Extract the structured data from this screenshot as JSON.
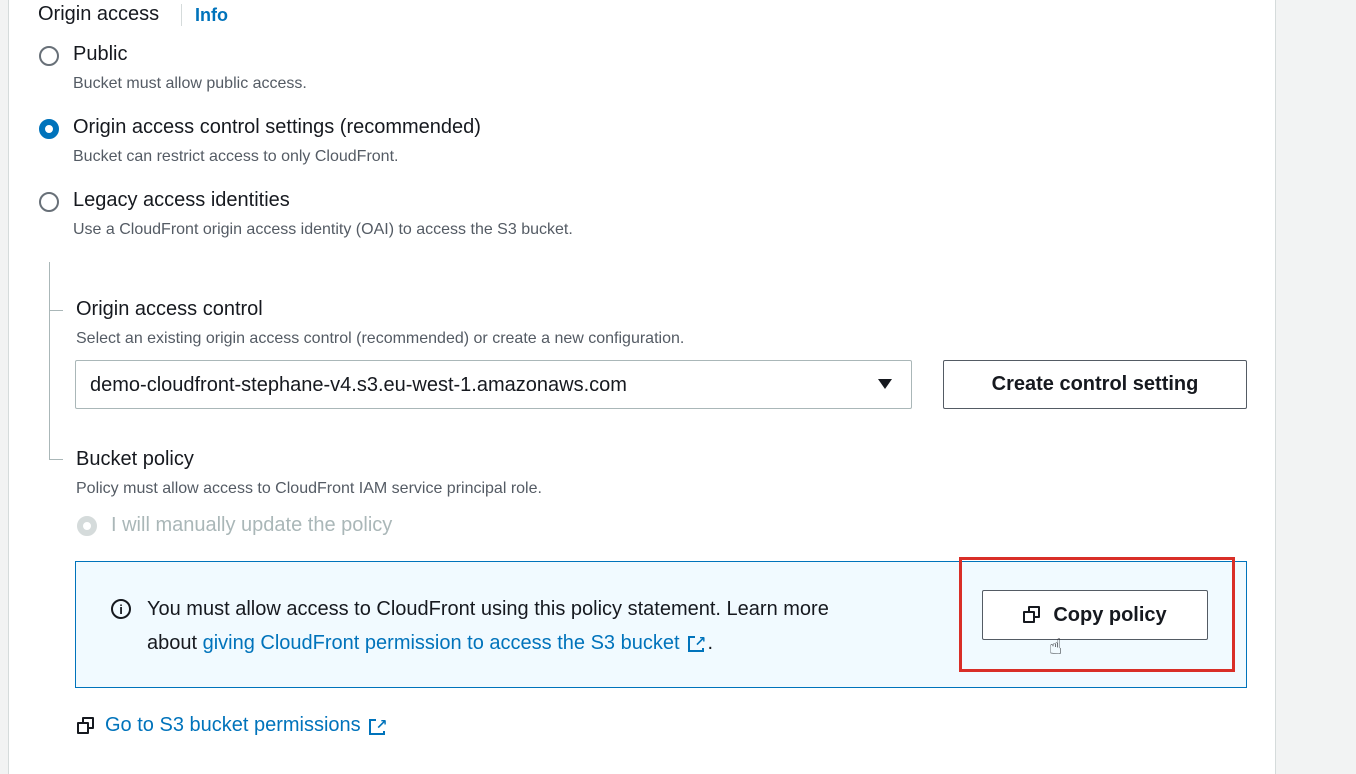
{
  "origin_access": {
    "label": "Origin access",
    "info": "Info",
    "options": [
      {
        "title": "Public",
        "desc": "Bucket must allow public access.",
        "checked": false
      },
      {
        "title": "Origin access control settings (recommended)",
        "desc": "Bucket can restrict access to only CloudFront.",
        "checked": true
      },
      {
        "title": "Legacy access identities",
        "desc": "Use a CloudFront origin access identity (OAI) to access the S3 bucket.",
        "checked": false
      }
    ]
  },
  "origin_access_control": {
    "label": "Origin access control",
    "desc": "Select an existing origin access control (recommended) or create a new configuration.",
    "selected": "demo-cloudfront-stephane-v4.s3.eu-west-1.amazonaws.com",
    "create_button": "Create control setting"
  },
  "bucket_policy": {
    "label": "Bucket policy",
    "desc": "Policy must allow access to CloudFront IAM service principal role.",
    "manual_option": "I will manually update the policy"
  },
  "alert": {
    "text_before": "You must allow access to CloudFront using this policy statement. Learn more",
    "text_about": "about ",
    "link_text": "giving CloudFront permission to access the S3 bucket",
    "text_after": ".",
    "copy_button": "Copy policy"
  },
  "footer_link": "Go to S3 bucket permissions",
  "icons": {
    "info": "info-icon",
    "copy": "copy-icon",
    "external": "external-link-icon",
    "caret": "caret-down-icon",
    "cursor": "hand-cursor-icon"
  },
  "colors": {
    "accent": "#0073bb",
    "highlight": "#d92e27",
    "alert_bg": "#f1faff"
  }
}
